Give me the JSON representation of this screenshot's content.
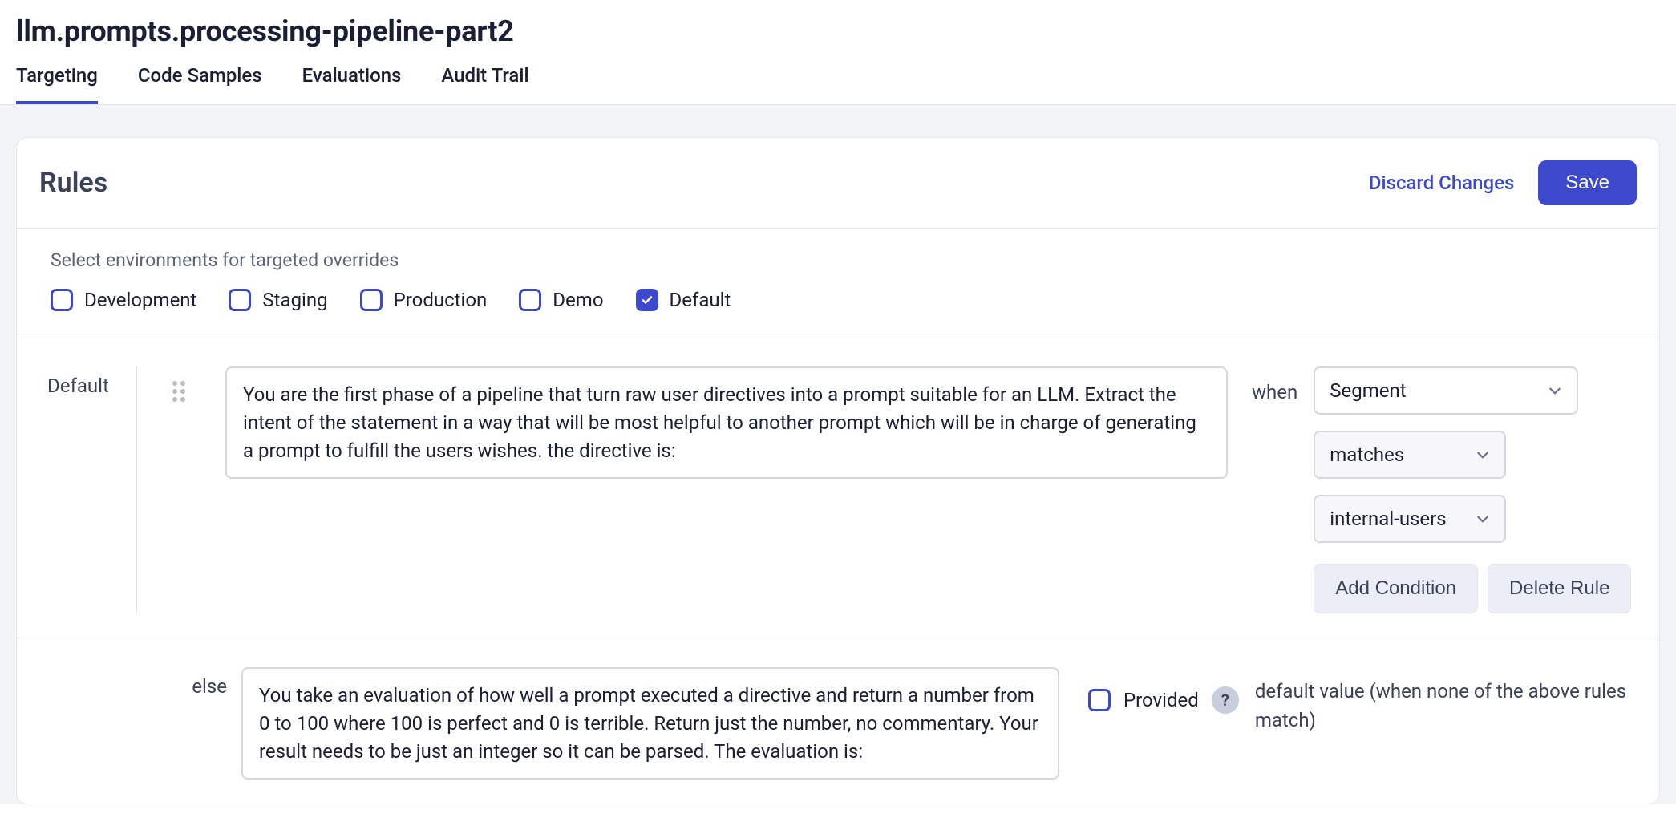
{
  "page_title": "llm.prompts.processing-pipeline-part2",
  "tabs": [
    {
      "label": "Targeting",
      "active": true
    },
    {
      "label": "Code Samples",
      "active": false
    },
    {
      "label": "Evaluations",
      "active": false
    },
    {
      "label": "Audit Trail",
      "active": false
    }
  ],
  "rules_panel": {
    "title": "Rules",
    "discard_label": "Discard Changes",
    "save_label": "Save",
    "env_instruction": "Select environments for targeted overrides",
    "environments": [
      {
        "label": "Development",
        "checked": false
      },
      {
        "label": "Staging",
        "checked": false
      },
      {
        "label": "Production",
        "checked": false
      },
      {
        "label": "Demo",
        "checked": false
      },
      {
        "label": "Default",
        "checked": true
      }
    ],
    "rule": {
      "label": "Default",
      "text": "You are the first phase of a pipeline that turn raw user directives into a prompt suitable for an LLM. Extract the intent of the statement in a way that will be most helpful to another prompt which will be in charge of generating a prompt to fulfill the users wishes. the directive is:",
      "when_label": "when",
      "segment_select": "Segment",
      "operator_select": "matches",
      "value_select": "internal-users",
      "add_condition_label": "Add Condition",
      "delete_rule_label": "Delete Rule"
    },
    "else_rule": {
      "label": "else",
      "text": "You take an evaluation of how well a prompt executed a directive and return a number from 0 to 100 where 100 is perfect and 0 is terrible. Return just the number, no commentary. Your result needs to be just an integer so it can be parsed. The evaluation is:",
      "provided_label": "Provided",
      "provided_checked": false,
      "help_icon": "?",
      "description": "default value (when none of the above rules match)"
    }
  }
}
